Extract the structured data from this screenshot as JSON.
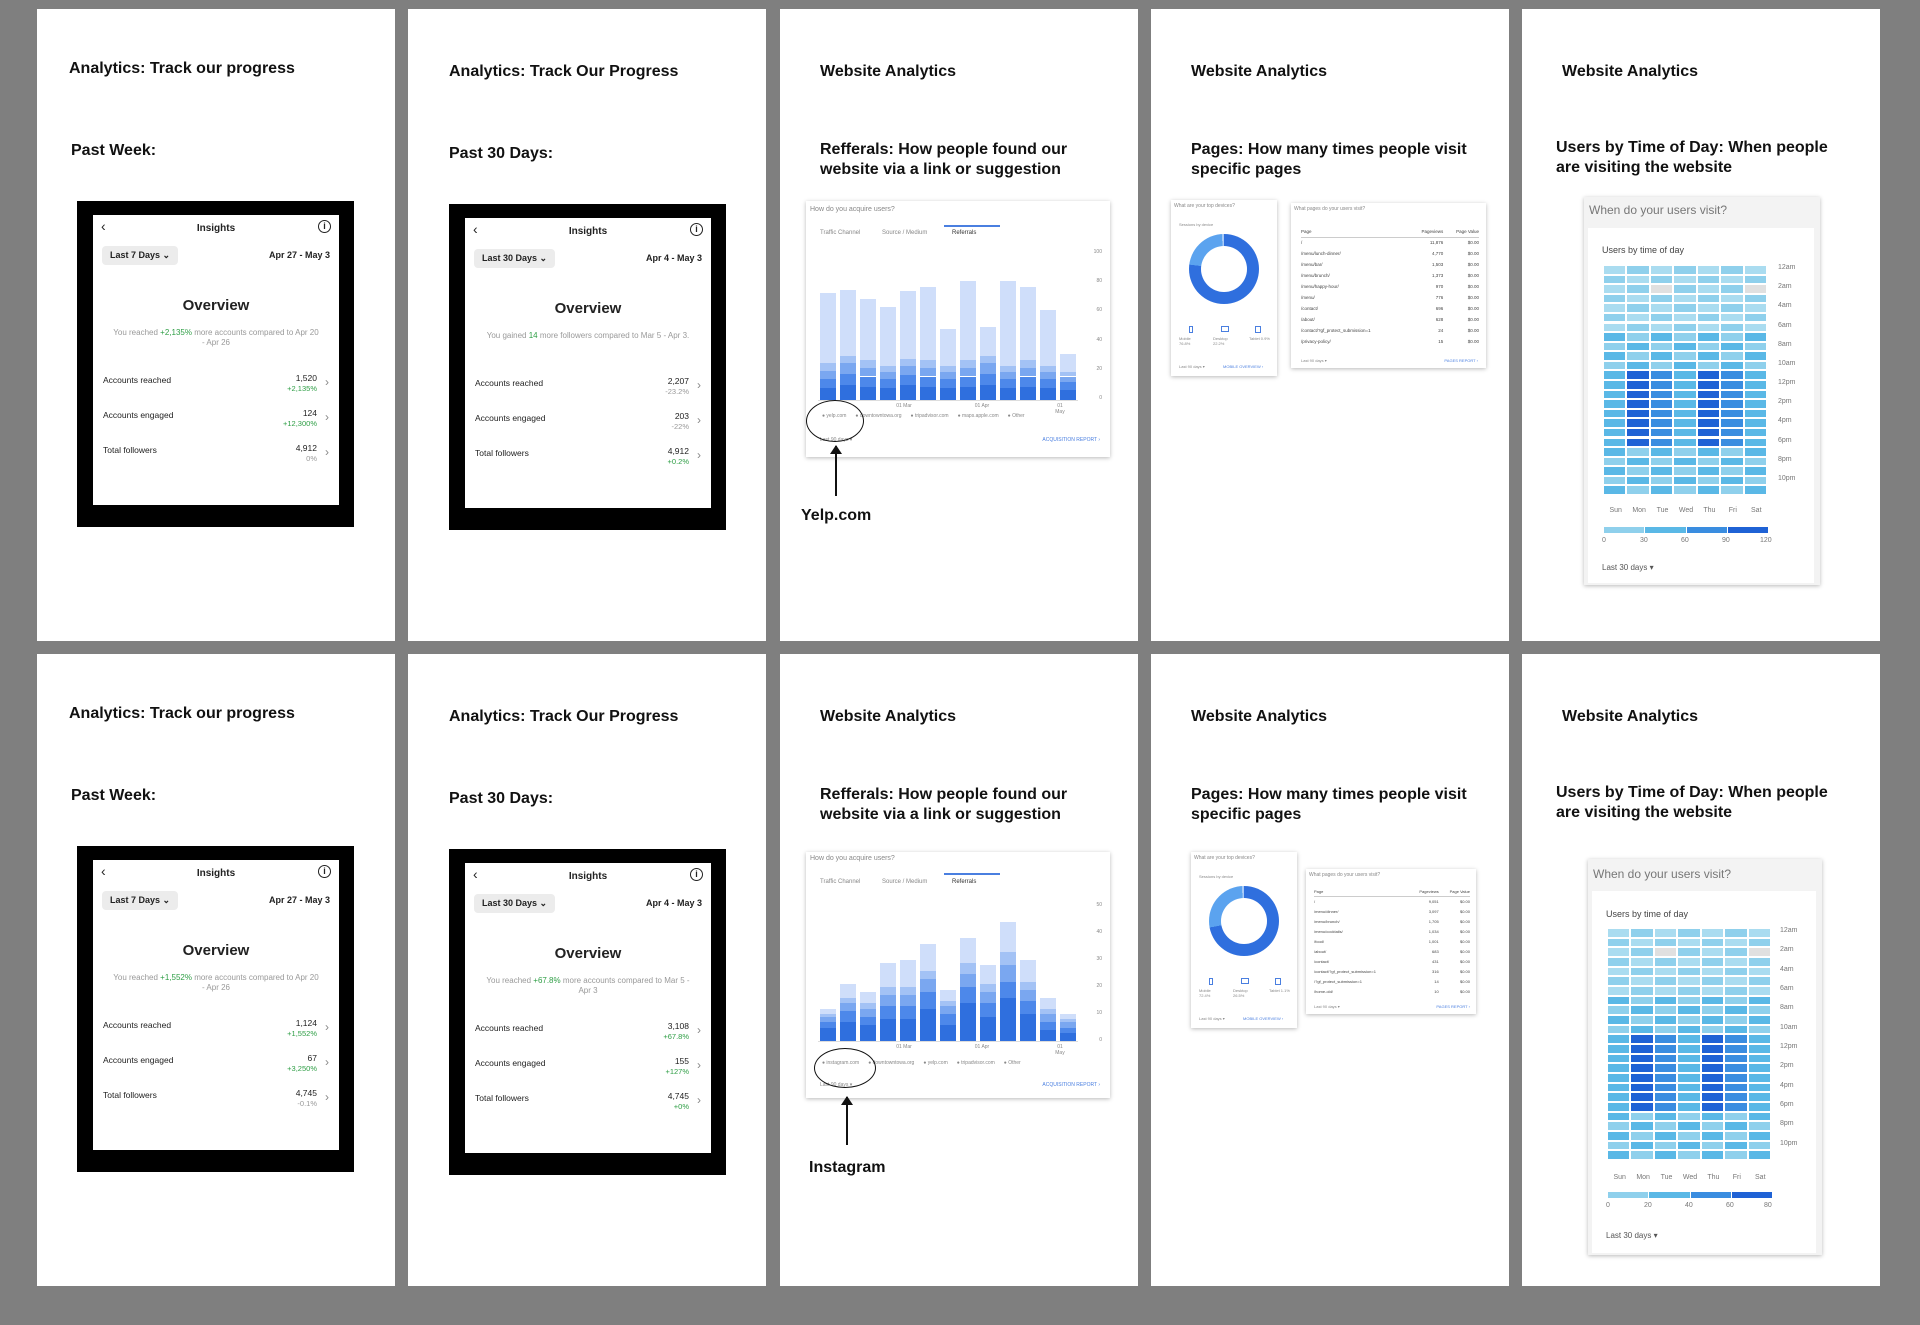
{
  "rows": [
    {
      "ig7": {
        "title": "Analytics: Track our progress",
        "period": "Past Week:",
        "header": "Insights",
        "filter": "Last 7 Days ⌄",
        "range": "Apr 27 - May 3",
        "overview": "Overview",
        "sub_pre": "You reached ",
        "sub_hl": "+2,135%",
        "sub_post": " more accounts compared to Apr 20 - Apr 26",
        "metrics": [
          {
            "label": "Accounts reached",
            "value": "1,520",
            "change": "+2,135%"
          },
          {
            "label": "Accounts engaged",
            "value": "124",
            "change": "+12,300%"
          },
          {
            "label": "Total followers",
            "value": "4,912",
            "change": "0%"
          }
        ]
      },
      "ig30": {
        "title": "Analytics: Track Our Progress",
        "period": "Past 30 Days:",
        "header": "Insights",
        "filter": "Last 30 Days ⌄",
        "range": "Apr 4 - May 3",
        "overview": "Overview",
        "sub_pre": "You gained ",
        "sub_hl": "14",
        "sub_post": " more followers compared to Mar 5 - Apr 3.",
        "metrics": [
          {
            "label": "Accounts reached",
            "value": "2,207",
            "change": "-23.2%"
          },
          {
            "label": "Accounts engaged",
            "value": "203",
            "change": "-22%"
          },
          {
            "label": "Total followers",
            "value": "4,912",
            "change": "+0.2%"
          }
        ]
      },
      "ref": {
        "title": "Website Analytics",
        "subtitle": "Refferals: How people found our website via a link or suggestion",
        "card_q": "How do you acquire users?",
        "tabs": [
          "Traffic Channel",
          "Source / Medium",
          "Referrals"
        ],
        "legend": [
          "● yelp.com",
          "● downtowntowa.org",
          "● tripadvisor.com",
          "● maps.apple.com",
          "● Other"
        ],
        "footer_left": "Last 90 days ▾",
        "footer_right": "ACQUISITION REPORT  ›",
        "xticks": [
          "01 Mar",
          "01 Apr",
          "01 May"
        ],
        "yticks": [
          "100",
          "80",
          "60",
          "40",
          "20",
          "0"
        ],
        "annotation": "Yelp.com",
        "chart_data": {
          "type": "bar",
          "stacked": true,
          "categories": [
            "1",
            "2",
            "3",
            "4",
            "5",
            "6",
            "7",
            "8",
            "9",
            "10",
            "11",
            "12",
            "13"
          ],
          "ylim": [
            0,
            100
          ],
          "series": [
            {
              "name": "yelp.com",
              "color": "#2f6fde",
              "values": [
                8,
                10,
                9,
                8,
                10,
                9,
                8,
                9,
                10,
                8,
                9,
                8,
                7
              ]
            },
            {
              "name": "downtowntowa.org",
              "color": "#4d88ea",
              "values": [
                6,
                8,
                7,
                6,
                7,
                7,
                6,
                7,
                8,
                6,
                7,
                6,
                5
              ]
            },
            {
              "name": "tripadvisor.com",
              "color": "#7aa7f0",
              "values": [
                6,
                7,
                6,
                5,
                6,
                6,
                5,
                6,
                7,
                5,
                6,
                5,
                4
              ]
            },
            {
              "name": "maps.apple.com",
              "color": "#a3c2f5",
              "values": [
                5,
                5,
                5,
                4,
                5,
                5,
                4,
                5,
                5,
                4,
                5,
                4,
                3
              ]
            },
            {
              "name": "Other",
              "color": "#cfdefa",
              "values": [
                48,
                45,
                42,
                40,
                46,
                50,
                25,
                54,
                20,
                58,
                50,
                38,
                12
              ]
            }
          ]
        }
      },
      "pages": {
        "title": "Website Analytics",
        "subtitle": "Pages: How many times people visit specific pages",
        "dev_q": "What are your top devices?",
        "dev_lab": "Sessions by device",
        "dev_stats": [
          "Mobile 76.8%",
          "Desktop 22.2%",
          "Tablet 0.9%"
        ],
        "dev_footer_left": "Last 90 days ▾",
        "dev_footer_right": "MOBILE OVERVIEW  ›",
        "pg_q": "What pages do your users visit?",
        "pg_cols": [
          "Page",
          "Pageviews",
          "Page Value"
        ],
        "pg_rows": [
          [
            "/",
            "11,876",
            "$0.00"
          ],
          [
            "/menu/lunch-dinner/",
            "4,770",
            "$0.00"
          ],
          [
            "/menu/bar/",
            "1,503",
            "$0.00"
          ],
          [
            "/menu/brunch/",
            "1,373",
            "$0.00"
          ],
          [
            "/menu/happy-hour/",
            "970",
            "$0.00"
          ],
          [
            "/menu/",
            "776",
            "$0.00"
          ],
          [
            "/contact/",
            "696",
            "$0.00"
          ],
          [
            "/about/",
            "628",
            "$0.00"
          ],
          [
            "/contact/?gf_protect_submission=1",
            "24",
            "$0.00"
          ],
          [
            "/privacy-policy/",
            "15",
            "$0.00"
          ]
        ],
        "pg_footer_left": "Last 90 days ▾",
        "pg_footer_right": "PAGES REPORT  ›"
      },
      "tod": {
        "title": "Website Analytics",
        "subtitle": "Users by Time of Day: When people are visiting the website",
        "card_q": "When do your users visit?",
        "chart_title": "Users by time of day",
        "hours": [
          "12am",
          "2am",
          "4am",
          "6am",
          "8am",
          "10am",
          "12pm",
          "2pm",
          "4pm",
          "6pm",
          "8pm",
          "10pm"
        ],
        "days": [
          "Sun",
          "Mon",
          "Tue",
          "Wed",
          "Thu",
          "Fri",
          "Sat"
        ],
        "scale": [
          "0",
          "30",
          "60",
          "90",
          "120"
        ],
        "footer": "Last 30 days ▾"
      }
    },
    {
      "ig7": {
        "title": "Analytics: Track our progress",
        "period": "Past Week:",
        "header": "Insights",
        "filter": "Last 7 Days ⌄",
        "range": "Apr 27 - May 3",
        "overview": "Overview",
        "sub_pre": "You reached ",
        "sub_hl": "+1,552%",
        "sub_post": " more accounts compared to Apr 20 - Apr 26",
        "metrics": [
          {
            "label": "Accounts reached",
            "value": "1,124",
            "change": "+1,552%"
          },
          {
            "label": "Accounts engaged",
            "value": "67",
            "change": "+3,250%"
          },
          {
            "label": "Total followers",
            "value": "4,745",
            "change": "-0.1%"
          }
        ]
      },
      "ig30": {
        "title": "Analytics: Track Our Progress",
        "period": "Past 30 Days:",
        "header": "Insights",
        "filter": "Last 30 Days ⌄",
        "range": "Apr 4 - May 3",
        "overview": "Overview",
        "sub_pre": "You reached ",
        "sub_hl": "+67.8%",
        "sub_post": " more accounts compared to Mar 5 - Apr 3",
        "metrics": [
          {
            "label": "Accounts reached",
            "value": "3,108",
            "change": "+67.8%"
          },
          {
            "label": "Accounts engaged",
            "value": "155",
            "change": "+127%"
          },
          {
            "label": "Total followers",
            "value": "4,745",
            "change": "+0%"
          }
        ]
      },
      "ref": {
        "title": "Website Analytics",
        "subtitle": "Refferals: How people found our website via a link or suggestion",
        "card_q": "How do you acquire users?",
        "tabs": [
          "Traffic Channel",
          "Source / Medium",
          "Referrals"
        ],
        "legend": [
          "● instagram.com",
          "● downtowntowa.org",
          "● yelp.com",
          "● tripadvisor.com",
          "● Other"
        ],
        "footer_left": "Last 90 days ▾",
        "footer_right": "ACQUISITION REPORT  ›",
        "xticks": [
          "01 Mar",
          "01 Apr",
          "01 May"
        ],
        "yticks": [
          "50",
          "40",
          "30",
          "20",
          "10",
          "0"
        ],
        "annotation": "Instagram",
        "chart_data": {
          "type": "bar",
          "stacked": true,
          "categories": [
            "1",
            "2",
            "3",
            "4",
            "5",
            "6",
            "7",
            "8",
            "9",
            "10",
            "11",
            "12",
            "13"
          ],
          "ylim": [
            0,
            50
          ],
          "series": [
            {
              "name": "instagram.com",
              "color": "#2f6fde",
              "values": [
                5,
                7,
                6,
                8,
                8,
                12,
                6,
                14,
                9,
                16,
                10,
                4,
                3
              ]
            },
            {
              "name": "downtowntowa.org",
              "color": "#4d88ea",
              "values": [
                2,
                4,
                3,
                5,
                5,
                6,
                4,
                6,
                5,
                6,
                5,
                3,
                2
              ]
            },
            {
              "name": "yelp.com",
              "color": "#7aa7f0",
              "values": [
                2,
                3,
                3,
                4,
                4,
                5,
                3,
                5,
                4,
                6,
                4,
                3,
                2
              ]
            },
            {
              "name": "tripadvisor.com",
              "color": "#a3c2f5",
              "values": [
                1,
                2,
                2,
                3,
                3,
                3,
                2,
                4,
                3,
                5,
                3,
                2,
                1
              ]
            },
            {
              "name": "Other",
              "color": "#cfdefa",
              "values": [
                2,
                5,
                4,
                9,
                10,
                10,
                4,
                9,
                7,
                11,
                8,
                4,
                2
              ]
            }
          ]
        }
      },
      "pages": {
        "title": "Website Analytics",
        "subtitle": "Pages: How many times people visit specific pages",
        "dev_q": "What are your top devices?",
        "dev_lab": "Sessions by device",
        "dev_stats": [
          "Mobile 72.4%",
          "Desktop 26.5%",
          "Tablet 1.1%"
        ],
        "dev_footer_left": "Last 90 days ▾",
        "dev_footer_right": "MOBILE OVERVIEW  ›",
        "pg_q": "What pages do your users visit?",
        "pg_cols": [
          "Page",
          "Pageviews",
          "Page Value"
        ],
        "pg_rows": [
          [
            "/",
            "9,051",
            "$0.00"
          ],
          [
            "/menu/dinner/",
            "3,097",
            "$0.00"
          ],
          [
            "/menu/brunch/",
            "1,705",
            "$0.00"
          ],
          [
            "/menu/cocktails/",
            "1,034",
            "$0.00"
          ],
          [
            "/food/",
            "1,001",
            "$0.00"
          ],
          [
            "/about/",
            "683",
            "$0.00"
          ],
          [
            "/contact/",
            "431",
            "$0.00"
          ],
          [
            "/contact/?gf_protect_submission=1",
            "316",
            "$0.00"
          ],
          [
            "/?gf_protect_submission=1",
            "14",
            "$0.00"
          ],
          [
            "/home-old/",
            "10",
            "$0.00"
          ]
        ],
        "pg_footer_left": "Last 90 days ▾",
        "pg_footer_right": "PAGES REPORT  ›"
      },
      "tod": {
        "title": "Website Analytics",
        "subtitle": "Users by Time of Day: When people are visiting the website",
        "card_q": "When do your users visit?",
        "chart_title": "Users by time of day",
        "hours": [
          "12am",
          "2am",
          "4am",
          "6am",
          "8am",
          "10am",
          "12pm",
          "2pm",
          "4pm",
          "6pm",
          "8pm",
          "10pm"
        ],
        "days": [
          "Sun",
          "Mon",
          "Tue",
          "Wed",
          "Thu",
          "Fri",
          "Sat"
        ],
        "scale": [
          "0",
          "20",
          "40",
          "60",
          "80"
        ],
        "footer": "Last 30 days ▾"
      }
    }
  ]
}
